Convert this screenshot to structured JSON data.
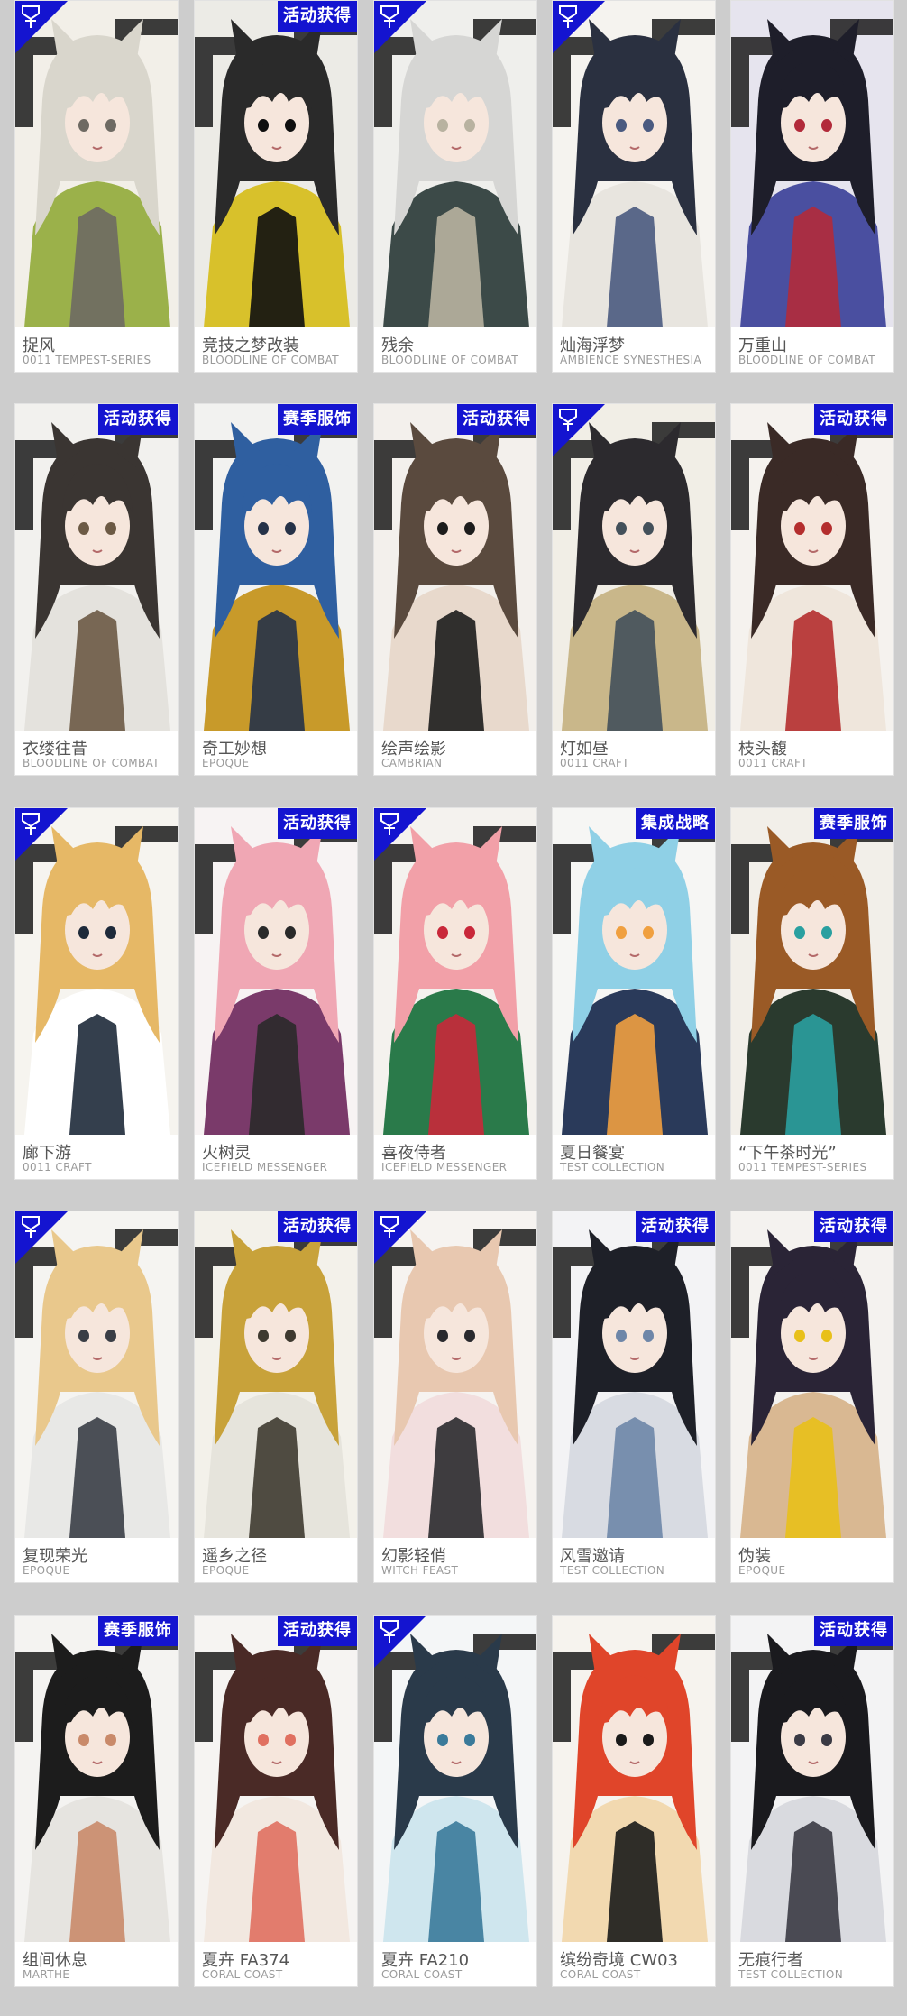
{
  "colors": {
    "background": "#cdcdcd",
    "card": "#ffffff",
    "tag": "#1414d0",
    "name": "#555555",
    "series": "#9a9a9a"
  },
  "rows": [
    [
      {
        "name": "捉风",
        "series": "0011 TEMPEST-SERIES",
        "tag": "",
        "corner_icon": "pin-ribbon-icon",
        "palette": [
          "#d9d6cc",
          "#9bb14a",
          "#6e6a63",
          "#f2efe8"
        ]
      },
      {
        "name": "竞技之梦改装",
        "series": "BLOODLINE OF COMBAT",
        "tag": "活动获得",
        "corner_icon": "",
        "palette": [
          "#2a2a2a",
          "#d8c12b",
          "#0f0f0f",
          "#ecebe6"
        ]
      },
      {
        "name": "残余",
        "series": "BLOODLINE OF COMBAT",
        "tag": "",
        "corner_icon": "pin-ribbon-icon",
        "palette": [
          "#d6d6d4",
          "#3c4a48",
          "#b8b2a0",
          "#efefec"
        ]
      },
      {
        "name": "灿海浮梦",
        "series": "AMBIENCE SYNESTHESIA",
        "tag": "",
        "corner_icon": "pin-ribbon-icon",
        "palette": [
          "#2a3040",
          "#e8e5df",
          "#4a5a80",
          "#f5f3ef"
        ]
      },
      {
        "name": "万重山",
        "series": "BLOODLINE OF COMBAT",
        "tag": "",
        "corner_icon": "",
        "palette": [
          "#1e1e2a",
          "#4a4fa0",
          "#b22a3a",
          "#e6e4ee"
        ]
      }
    ],
    [
      {
        "name": "衣缕往昔",
        "series": "BLOODLINE OF COMBAT",
        "tag": "活动获得",
        "corner_icon": "",
        "palette": [
          "#3a3532",
          "#e4e2dd",
          "#6c5a45",
          "#f2f1ee"
        ]
      },
      {
        "name": "奇工妙想",
        "series": "EPOQUE",
        "tag": "赛季服饰",
        "corner_icon": "",
        "palette": [
          "#2f5fa0",
          "#c89a2a",
          "#253248",
          "#f2f2f0"
        ]
      },
      {
        "name": "绘声绘影",
        "series": "CAMBRIAN",
        "tag": "活动获得",
        "corner_icon": "",
        "palette": [
          "#5a4a3e",
          "#e8d9cc",
          "#1c1c1c",
          "#f3f0ec"
        ]
      },
      {
        "name": "灯如昼",
        "series": "0011 CRAFT",
        "tag": "",
        "corner_icon": "pin-ribbon-icon",
        "palette": [
          "#2c2a2e",
          "#c9b78a",
          "#43505a",
          "#f1eee6"
        ]
      },
      {
        "name": "枝头馥",
        "series": "0011 CRAFT",
        "tag": "活动获得",
        "corner_icon": "",
        "palette": [
          "#3a2a26",
          "#efe6dc",
          "#b42e2e",
          "#f5f2ee"
        ]
      }
    ],
    [
      {
        "name": "廊下游",
        "series": "0011 CRAFT",
        "tag": "",
        "corner_icon": "pin-ribbon-icon",
        "palette": [
          "#e6b866",
          "#ffffff",
          "#1e2a3a",
          "#f6f4ef"
        ]
      },
      {
        "name": "火树灵",
        "series": "ICEFIELD MESSENGER",
        "tag": "活动获得",
        "corner_icon": "",
        "palette": [
          "#f0a7b4",
          "#7a3a6a",
          "#2a2a2a",
          "#f7f3f3"
        ]
      },
      {
        "name": "喜夜侍者",
        "series": "ICEFIELD MESSENGER",
        "tag": "",
        "corner_icon": "pin-ribbon-icon",
        "palette": [
          "#f2a0a8",
          "#2a7a4a",
          "#c9283a",
          "#f4f2ee"
        ]
      },
      {
        "name": "夏日餐宴",
        "series": "TEST COLLECTION",
        "tag": "集成战略",
        "corner_icon": "",
        "palette": [
          "#8fd0e6",
          "#2a3a5a",
          "#f0a040",
          "#f6f6f4"
        ]
      },
      {
        "name": "“下午茶时光”",
        "series": "0011 TEMPEST-SERIES",
        "tag": "赛季服饰",
        "corner_icon": "",
        "palette": [
          "#9a5a26",
          "#2a3a2e",
          "#2aa0a0",
          "#f2efe9"
        ]
      }
    ],
    [
      {
        "name": "复现荣光",
        "series": "EPOQUE",
        "tag": "",
        "corner_icon": "pin-ribbon-icon",
        "palette": [
          "#e9c88c",
          "#e8e8e6",
          "#3a3e46",
          "#f5f4f1"
        ]
      },
      {
        "name": "遥乡之径",
        "series": "EPOQUE",
        "tag": "活动获得",
        "corner_icon": "",
        "palette": [
          "#c8a23a",
          "#e6e4dc",
          "#3e3a30",
          "#f3f1ea"
        ]
      },
      {
        "name": "幻影轻俏",
        "series": "WITCH FEAST",
        "tag": "",
        "corner_icon": "pin-ribbon-icon",
        "palette": [
          "#e8c8b0",
          "#f2dede",
          "#2a2a2e",
          "#f6f3f0"
        ]
      },
      {
        "name": "风雪邀请",
        "series": "TEST COLLECTION",
        "tag": "活动获得",
        "corner_icon": "",
        "palette": [
          "#1e2028",
          "#d8dbe2",
          "#6e86a8",
          "#f3f3f5"
        ]
      },
      {
        "name": "伪装",
        "series": "EPOQUE",
        "tag": "活动获得",
        "corner_icon": "",
        "palette": [
          "#2a2436",
          "#d9b892",
          "#e8c01a",
          "#f4f2ef"
        ]
      }
    ],
    [
      {
        "name": "组间休息",
        "series": "MARTHE",
        "tag": "赛季服饰",
        "corner_icon": "",
        "palette": [
          "#1c1c1c",
          "#e6e4e0",
          "#c98a6a",
          "#f4f3f1"
        ]
      },
      {
        "name": "夏卉 FA374",
        "series": "CORAL COAST",
        "tag": "活动获得",
        "corner_icon": "",
        "palette": [
          "#4a2a26",
          "#f2e8e0",
          "#e07060",
          "#f6f4f2"
        ]
      },
      {
        "name": "夏卉 FA210",
        "series": "CORAL COAST",
        "tag": "",
        "corner_icon": "pin-ribbon-icon",
        "palette": [
          "#2a3a4a",
          "#cfe6ee",
          "#3a7a9a",
          "#f4f6f7"
        ]
      },
      {
        "name": "缤纷奇境 CW03",
        "series": "CORAL COAST",
        "tag": "",
        "corner_icon": "",
        "palette": [
          "#e0452a",
          "#f2d9b0",
          "#1a1a1a",
          "#f6f3ee"
        ]
      },
      {
        "name": "无痕行者",
        "series": "TEST COLLECTION",
        "tag": "活动获得",
        "corner_icon": "",
        "palette": [
          "#1a1a1e",
          "#d9dadf",
          "#3a3a44",
          "#f3f3f4"
        ]
      }
    ]
  ]
}
